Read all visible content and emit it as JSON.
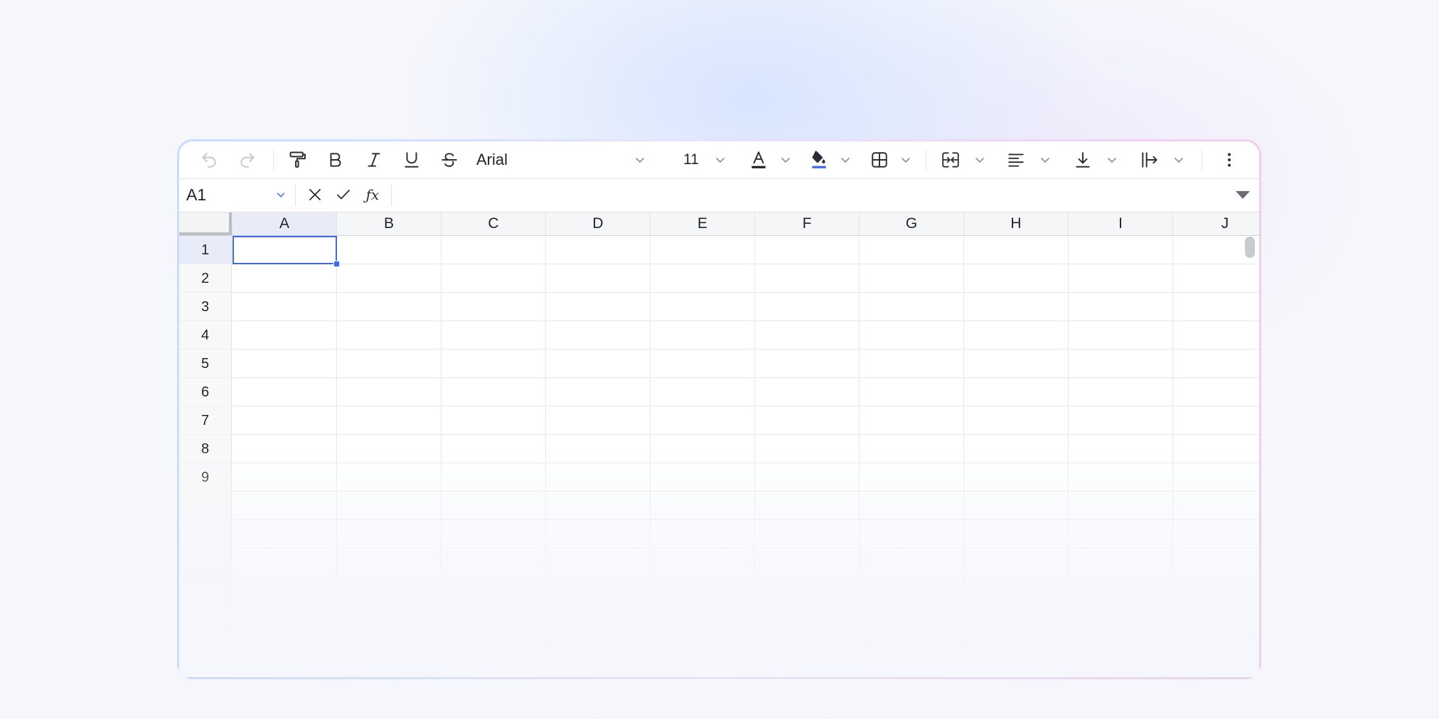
{
  "toolbar": {
    "items": [
      {
        "name": "undo-button",
        "icon": "undo-icon"
      },
      {
        "name": "redo-button",
        "icon": "redo-icon"
      },
      {
        "name": "format-painter-button",
        "icon": "paint-roller-icon"
      },
      {
        "name": "bold-button",
        "icon": "bold-icon"
      },
      {
        "name": "italic-button",
        "icon": "italic-icon"
      },
      {
        "name": "underline-button",
        "icon": "underline-icon"
      },
      {
        "name": "strikethrough-button",
        "icon": "strikethrough-icon"
      },
      {
        "name": "text-color-button",
        "icon": "text-color-icon"
      },
      {
        "name": "fill-color-button",
        "icon": "paint-bucket-icon"
      },
      {
        "name": "borders-button",
        "icon": "borders-icon"
      },
      {
        "name": "merge-cells-button",
        "icon": "merge-cells-icon"
      },
      {
        "name": "horizontal-align-button",
        "icon": "align-left-icon"
      },
      {
        "name": "vertical-align-button",
        "icon": "align-bottom-icon"
      },
      {
        "name": "text-wrap-button",
        "icon": "text-wrap-icon"
      },
      {
        "name": "more-options-button",
        "icon": "more-vertical-icon"
      }
    ],
    "font_family": "Arial",
    "font_size": "11"
  },
  "colors": {
    "accent": "#3e6ae1",
    "text_color_bar": "#1f2329",
    "fill_color_bar": "#3e6ae1"
  },
  "formula_bar": {
    "cell_reference": "A1",
    "fx_label": "ƒx",
    "formula_value": ""
  },
  "grid": {
    "columns": [
      "A",
      "B",
      "C",
      "D",
      "E",
      "F",
      "G",
      "H",
      "I",
      "J"
    ],
    "rows": [
      "1",
      "2",
      "3",
      "4",
      "5",
      "6",
      "7",
      "8",
      "9"
    ],
    "selected_cell": "A1"
  }
}
